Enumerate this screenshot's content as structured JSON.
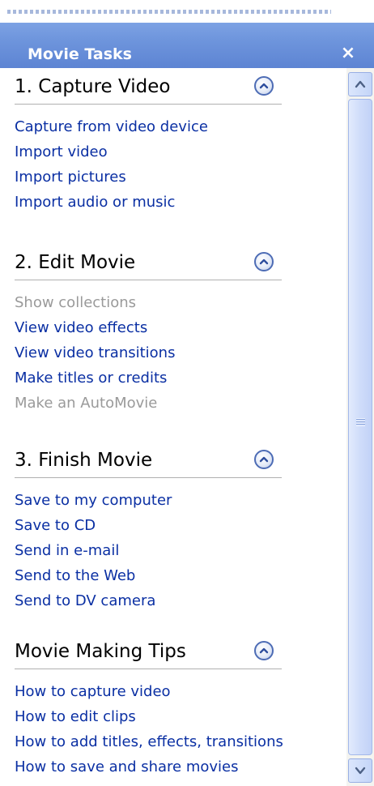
{
  "panel": {
    "title": "Movie Tasks",
    "close_label": "×"
  },
  "sections": [
    {
      "title": "1. Capture Video",
      "items": [
        {
          "label": "Capture from video device",
          "enabled": true
        },
        {
          "label": "Import video",
          "enabled": true
        },
        {
          "label": "Import pictures",
          "enabled": true
        },
        {
          "label": "Import audio or music",
          "enabled": true
        }
      ]
    },
    {
      "title": "2. Edit Movie",
      "items": [
        {
          "label": "Show collections",
          "enabled": false
        },
        {
          "label": "View video effects",
          "enabled": true
        },
        {
          "label": "View video transitions",
          "enabled": true
        },
        {
          "label": "Make titles or credits",
          "enabled": true
        },
        {
          "label": "Make an AutoMovie",
          "enabled": false
        }
      ]
    },
    {
      "title": "3. Finish Movie",
      "items": [
        {
          "label": "Save to my computer",
          "enabled": true
        },
        {
          "label": "Save to CD",
          "enabled": true
        },
        {
          "label": "Send in e-mail",
          "enabled": true
        },
        {
          "label": "Send to the Web",
          "enabled": true
        },
        {
          "label": "Send to DV camera",
          "enabled": true
        }
      ]
    },
    {
      "title": "Movie Making Tips",
      "items": [
        {
          "label": "How to capture video",
          "enabled": true
        },
        {
          "label": "How to edit clips",
          "enabled": true
        },
        {
          "label": "How to add titles, effects, transitions",
          "enabled": true
        },
        {
          "label": "How to save and share movies",
          "enabled": true
        }
      ]
    }
  ],
  "colors": {
    "link": "#0a2fa3",
    "disabled": "#9a9a9a",
    "titlebar": "#6f96dd"
  },
  "icons": {
    "close": "close-icon",
    "collapse": "chevron-up-circle-icon",
    "scroll_up": "arrow-up-icon",
    "scroll_down": "arrow-down-icon"
  }
}
